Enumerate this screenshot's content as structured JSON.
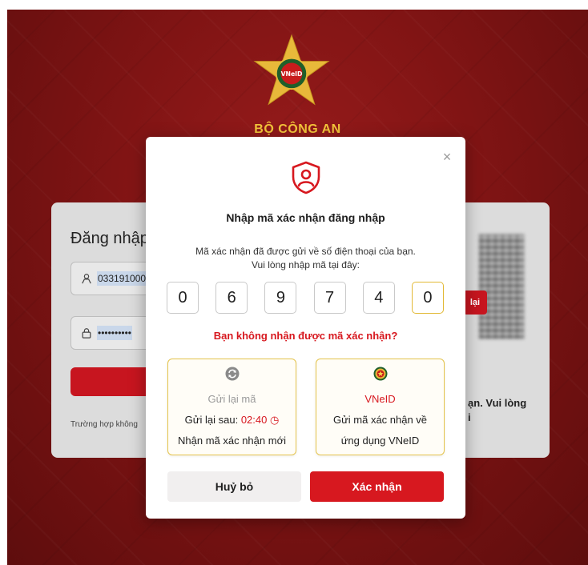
{
  "organization": {
    "name": "BỘ CÔNG AN",
    "emblem_text": "VNeID"
  },
  "background_login": {
    "title": "Đăng nhập",
    "username_value": "033191000",
    "password_value": "••••••••••",
    "footer_text": "Trường hợp không",
    "side_tag": "lại",
    "side_text_1": "ạn. Vui lòng",
    "side_text_2": "i"
  },
  "modal": {
    "title": "Nhập mã xác nhận đăng nhập",
    "description_line1": "Mã xác nhận đã được gửi về số điện thoại của bạn.",
    "description_line2": "Vui lòng nhập mã tại đây:",
    "otp_digits": [
      "0",
      "6",
      "9",
      "7",
      "4",
      "0"
    ],
    "no_code_link": "Bạn không nhận được mã xác nhận?",
    "resend_option": {
      "icon": "refresh-icon",
      "title": "Gửi lại mã",
      "countdown_label": "Gửi lại sau:",
      "countdown_value": "02:40",
      "subtitle": "Nhận mã xác nhận mới"
    },
    "vneid_option": {
      "icon": "vneid-emblem-icon",
      "title": "VNeID",
      "line1": "Gửi mã xác nhận về",
      "line2": "ứng dụng VNeID"
    },
    "cancel_label": "Huỷ bỏ",
    "confirm_label": "Xác nhận",
    "close_symbol": "×"
  },
  "colors": {
    "primary_red": "#d7181f",
    "gold": "#e5c44c",
    "background_red": "#801414"
  }
}
